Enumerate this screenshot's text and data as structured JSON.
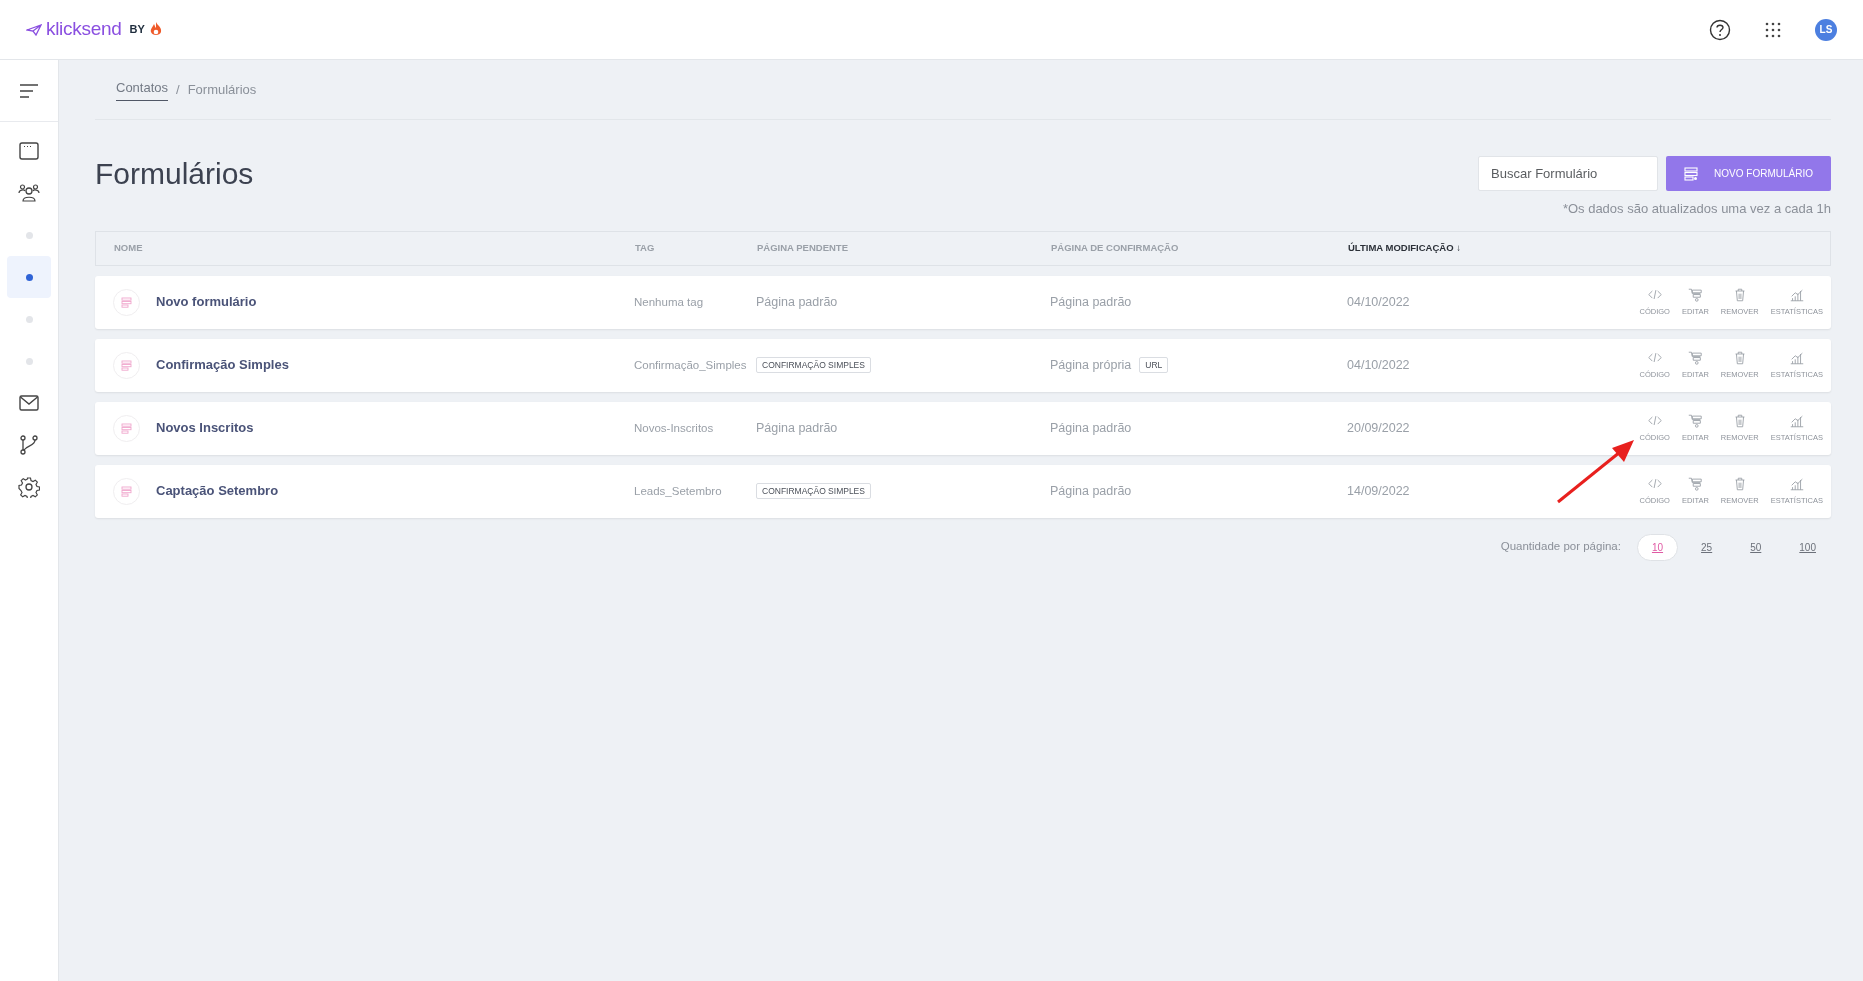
{
  "header": {
    "logo_text": "klicksend",
    "logo_by": "BY",
    "avatar": "LS"
  },
  "sidebar": {
    "items": [
      {
        "kind": "icon",
        "selected": false
      },
      {
        "kind": "icon",
        "selected": false
      },
      {
        "kind": "dot",
        "selected": false
      },
      {
        "kind": "dot",
        "selected": true
      },
      {
        "kind": "dot",
        "selected": false
      },
      {
        "kind": "dot",
        "selected": false
      },
      {
        "kind": "icon",
        "selected": false
      },
      {
        "kind": "icon",
        "selected": false
      },
      {
        "kind": "icon",
        "selected": false
      }
    ]
  },
  "breadcrumb": [
    {
      "label": "Contatos",
      "link": true
    },
    {
      "label": "Formulários",
      "link": false
    }
  ],
  "breadcrumb_separator": "/",
  "title": "Formulários",
  "search": {
    "placeholder": "Buscar Formulário"
  },
  "new_button": "NOVO FORMULÁRIO",
  "note": "*Os dados são atualizados uma vez a cada 1h",
  "table": {
    "columns": [
      {
        "label": "NOME",
        "sorted": false
      },
      {
        "label": "TAG",
        "sorted": false
      },
      {
        "label": "PÁGINA PENDENTE",
        "sorted": false
      },
      {
        "label": "PÁGINA DE CONFIRMAÇÃO",
        "sorted": false
      },
      {
        "label": "ÚLTIMA MODIFICAÇÃO ↓",
        "sorted": true
      }
    ],
    "rows": [
      {
        "name": "Novo formulário",
        "tag": "Nenhuma tag",
        "pending": {
          "text": "Página padrão"
        },
        "confirmation": {
          "text": "Página padrão"
        },
        "modified": "04/10/2022",
        "actions": [
          "CÓDIGO",
          "EDITAR",
          "REMOVER",
          "ESTATÍSTICAS"
        ]
      },
      {
        "name": "Confirmação Simples",
        "tag": "Confirmação_Simples",
        "pending": {
          "badge": "CONFIRMAÇÃO SIMPLES"
        },
        "confirmation": {
          "text": "Página própria",
          "badge": "URL"
        },
        "modified": "04/10/2022",
        "actions": [
          "CÓDIGO",
          "EDITAR",
          "REMOVER",
          "ESTATÍSTICAS"
        ]
      },
      {
        "name": "Novos Inscritos",
        "tag": "Novos-Inscritos",
        "pending": {
          "text": "Página padrão"
        },
        "confirmation": {
          "text": "Página padrão"
        },
        "modified": "20/09/2022",
        "actions": [
          "CÓDIGO",
          "EDITAR",
          "REMOVER",
          "ESTATÍSTICAS"
        ]
      },
      {
        "name": "Captação Setembro",
        "tag": "Leads_Setembro",
        "pending": {
          "badge": "CONFIRMAÇÃO SIMPLES"
        },
        "confirmation": {
          "text": "Página padrão"
        },
        "modified": "14/09/2022",
        "actions": [
          "CÓDIGO",
          "EDITAR",
          "REMOVER",
          "ESTATÍSTICAS"
        ]
      }
    ]
  },
  "pagination": {
    "label": "Quantidade por página:",
    "options": [
      {
        "label": "10",
        "selected": true
      },
      {
        "label": "25",
        "selected": false
      },
      {
        "label": "50",
        "selected": false
      },
      {
        "label": "100",
        "selected": false
      }
    ]
  }
}
